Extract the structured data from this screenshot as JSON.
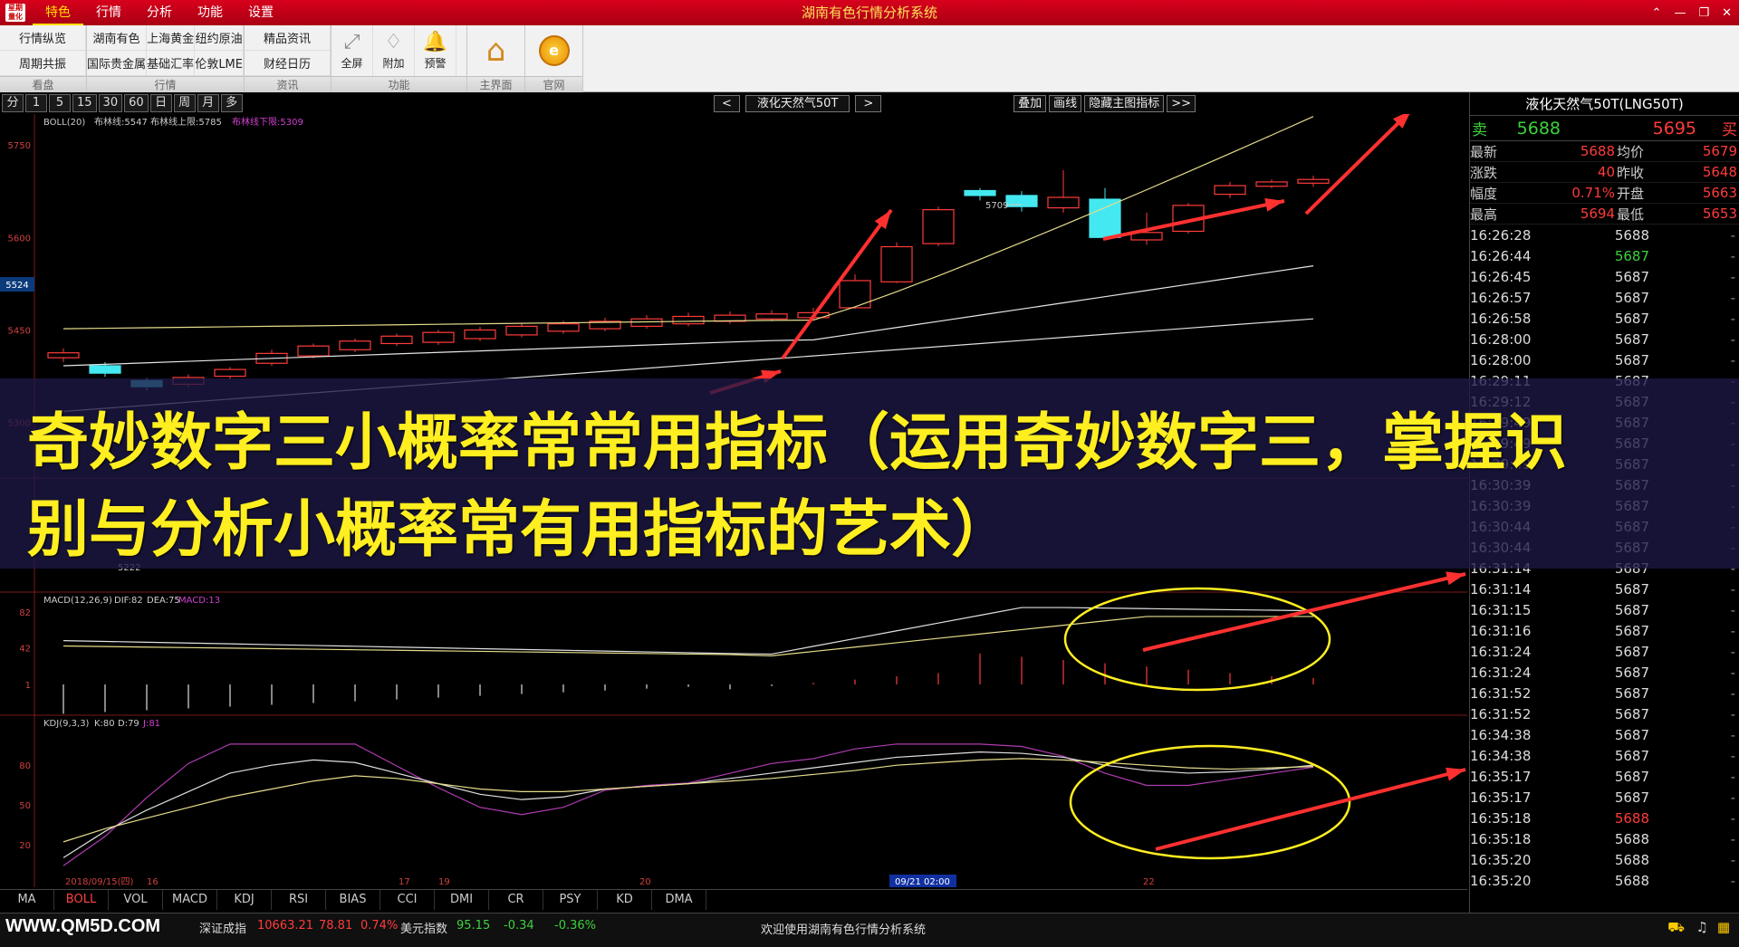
{
  "titlebar": {
    "logo": "星期\n量化",
    "menu": [
      "特色",
      "行情",
      "分析",
      "功能",
      "设置"
    ],
    "title": "湖南有色行情分析系统",
    "controls": [
      "⌃",
      "—",
      "❐",
      "✕"
    ]
  },
  "toolbar": {
    "groups": [
      {
        "caption": "看盘",
        "buttons": [
          "行情纵览",
          "周期共振"
        ]
      },
      {
        "caption": "行情",
        "buttons": [
          "湖南有色",
          "国际贵金属",
          "上海黄金",
          "基础汇率",
          "纽约原油",
          "伦敦LME"
        ]
      },
      {
        "caption": "资讯",
        "buttons": [
          "精品资讯",
          "财经日历"
        ]
      }
    ],
    "func_caption": "功能",
    "func_buttons": [
      {
        "label": "全屏",
        "icon": "fullscreen-icon",
        "glyph": "⤢"
      },
      {
        "label": "附加",
        "icon": "tag-icon",
        "glyph": "♢"
      },
      {
        "label": "预警",
        "icon": "bell-icon",
        "glyph": "🔔"
      }
    ],
    "home_caption": "主界面",
    "site_caption": "官网"
  },
  "periods": [
    "分",
    "1",
    "5",
    "15",
    "30",
    "60",
    "日",
    "周",
    "月",
    "多"
  ],
  "nav": {
    "prev": "<",
    "symbol": "液化天然气50T",
    "next": ">"
  },
  "chart_tools": [
    "叠加",
    "画线",
    "隐藏主图指标",
    ">>"
  ],
  "chart": {
    "boll_label": "BOLL(20)",
    "boll_mid": "布林线:5547",
    "boll_up": "布林线上限:5785",
    "boll_low": "布林线下限:5309",
    "price_labels": [
      "5750",
      "5600",
      "5450",
      "5300"
    ],
    "current_tag": "5524",
    "high_note": "5709",
    "low_note": "5222",
    "macd_label": "MACD(12,26,9)",
    "macd_dif": "DIF:82",
    "macd_dea": "DEA:75",
    "macd_val": "MACD:13",
    "macd_ticks": [
      "82",
      "42",
      "1"
    ],
    "kdj_label": "KDJ(9,3,3)",
    "kdj_k": "K:80",
    "kdj_d": "D:79",
    "kdj_j": "J:81",
    "kdj_ticks": [
      "80",
      "50",
      "20"
    ],
    "date_labels": [
      "2018/09/15(四)",
      "16",
      "17",
      "19",
      "20",
      "09/21 02:00",
      "22"
    ]
  },
  "indicator_tabs": [
    "MA",
    "BOLL",
    "VOL",
    "MACD",
    "KDJ",
    "RSI",
    "BIAS",
    "CCI",
    "DMI",
    "CR",
    "PSY",
    "KD",
    "DMA"
  ],
  "status": {
    "watermark": "WWW.QM5D.COM",
    "items": [
      "深证成指",
      "10663.21",
      "78.81",
      "0.74%",
      "美元指数",
      "95.15",
      "-0.34",
      "-0.36%"
    ],
    "welcome": "欢迎使用湖南有色行情分析系统"
  },
  "quote": {
    "title": "液化天然气50T(LNG50T)",
    "sell_label": "卖",
    "sell": "5688",
    "buy": "5695",
    "buy_label": "买",
    "stats": [
      {
        "l1": "最新",
        "v1": "5688",
        "l2": "均价",
        "v2": "5679"
      },
      {
        "l1": "涨跌",
        "v1": "40",
        "l2": "昨收",
        "v2": "5648"
      },
      {
        "l1": "幅度",
        "v1": "0.71%",
        "l2": "开盘",
        "v2": "5663"
      },
      {
        "l1": "最高",
        "v1": "5694",
        "l2": "最低",
        "v2": "5653"
      }
    ],
    "ticks": [
      [
        "16:26:28",
        "5688"
      ],
      [
        "16:26:44",
        "5687"
      ],
      [
        "16:26:45",
        "5687"
      ],
      [
        "16:26:57",
        "5687"
      ],
      [
        "16:26:58",
        "5687"
      ],
      [
        "16:28:00",
        "5687"
      ],
      [
        "16:28:00",
        "5687"
      ],
      [
        "16:29:11",
        "5687"
      ],
      [
        "16:29:12",
        "5687"
      ],
      [
        "16:29:49",
        "5687"
      ],
      [
        "16:29:49",
        "5687"
      ],
      [
        "16:29:49",
        "5687"
      ],
      [
        "16:30:39",
        "5687"
      ],
      [
        "16:30:39",
        "5687"
      ],
      [
        "16:30:44",
        "5687"
      ],
      [
        "16:30:44",
        "5687"
      ],
      [
        "16:31:14",
        "5687"
      ],
      [
        "16:31:14",
        "5687"
      ],
      [
        "16:31:15",
        "5687"
      ],
      [
        "16:31:16",
        "5687"
      ],
      [
        "16:31:24",
        "5687"
      ],
      [
        "16:31:24",
        "5687"
      ],
      [
        "16:31:52",
        "5687"
      ],
      [
        "16:31:52",
        "5687"
      ],
      [
        "16:34:38",
        "5687"
      ],
      [
        "16:34:38",
        "5687"
      ],
      [
        "16:35:17",
        "5687"
      ],
      [
        "16:35:17",
        "5687"
      ],
      [
        "16:35:18",
        "5688"
      ],
      [
        "16:35:18",
        "5688"
      ],
      [
        "16:35:20",
        "5688"
      ],
      [
        "16:35:20",
        "5688"
      ]
    ],
    "tick_dash": "-"
  },
  "banner": {
    "line1": "奇妙数字三小概率常常用指标（运用奇妙数字三，掌握识",
    "line2": "别与分析小概率常有用指标的艺术）"
  },
  "colors": {
    "up": "#ff3b3b",
    "down": "#44e8f0",
    "green": "#3cd23c",
    "yellow": "#ffee20",
    "arrow": "#ff3030"
  },
  "candles": [
    {
      "o": 5405,
      "c": 5413,
      "h": 5420,
      "l": 5398
    },
    {
      "o": 5392,
      "c": 5380,
      "h": 5398,
      "l": 5374
    },
    {
      "o": 5368,
      "c": 5358,
      "h": 5372,
      "l": 5352
    },
    {
      "o": 5362,
      "c": 5373,
      "h": 5378,
      "l": 5357
    },
    {
      "o": 5375,
      "c": 5386,
      "h": 5390,
      "l": 5370
    },
    {
      "o": 5396,
      "c": 5412,
      "h": 5418,
      "l": 5392
    },
    {
      "o": 5408,
      "c": 5424,
      "h": 5428,
      "l": 5404
    },
    {
      "o": 5418,
      "c": 5432,
      "h": 5436,
      "l": 5414
    },
    {
      "o": 5428,
      "c": 5440,
      "h": 5444,
      "l": 5424
    },
    {
      "o": 5430,
      "c": 5446,
      "h": 5450,
      "l": 5426
    },
    {
      "o": 5436,
      "c": 5450,
      "h": 5455,
      "l": 5432
    },
    {
      "o": 5442,
      "c": 5456,
      "h": 5460,
      "l": 5438
    },
    {
      "o": 5448,
      "c": 5460,
      "h": 5465,
      "l": 5444
    },
    {
      "o": 5452,
      "c": 5464,
      "h": 5470,
      "l": 5448
    },
    {
      "o": 5456,
      "c": 5468,
      "h": 5474,
      "l": 5452
    },
    {
      "o": 5460,
      "c": 5472,
      "h": 5478,
      "l": 5456
    },
    {
      "o": 5464,
      "c": 5474,
      "h": 5480,
      "l": 5460
    },
    {
      "o": 5468,
      "c": 5476,
      "h": 5482,
      "l": 5464
    },
    {
      "o": 5470,
      "c": 5478,
      "h": 5486,
      "l": 5466
    },
    {
      "o": 5486,
      "c": 5530,
      "h": 5540,
      "l": 5484
    },
    {
      "o": 5528,
      "c": 5585,
      "h": 5592,
      "l": 5526
    },
    {
      "o": 5590,
      "c": 5645,
      "h": 5650,
      "l": 5586
    },
    {
      "o": 5676,
      "c": 5668,
      "h": 5680,
      "l": 5660
    },
    {
      "o": 5668,
      "c": 5650,
      "h": 5675,
      "l": 5642
    },
    {
      "o": 5648,
      "c": 5665,
      "h": 5709,
      "l": 5640
    },
    {
      "o": 5662,
      "c": 5600,
      "h": 5680,
      "l": 5596
    },
    {
      "o": 5596,
      "c": 5608,
      "h": 5640,
      "l": 5588
    },
    {
      "o": 5610,
      "c": 5652,
      "h": 5656,
      "l": 5606
    },
    {
      "o": 5670,
      "c": 5684,
      "h": 5690,
      "l": 5664
    },
    {
      "o": 5683,
      "c": 5690,
      "h": 5694,
      "l": 5680
    },
    {
      "o": 5688,
      "c": 5694,
      "h": 5700,
      "l": 5682
    }
  ]
}
